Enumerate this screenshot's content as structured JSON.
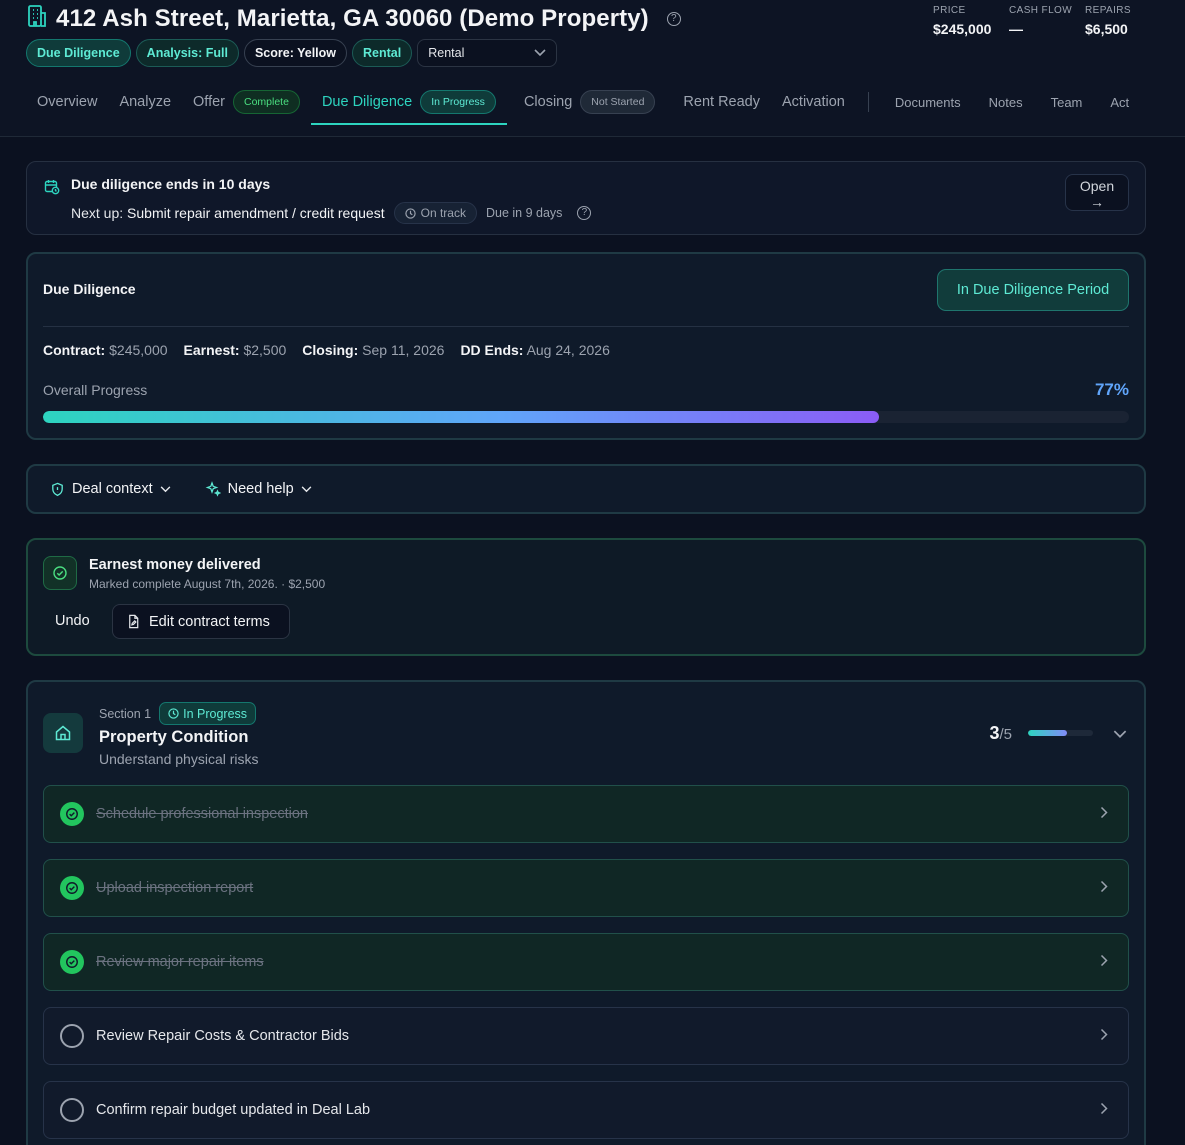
{
  "header": {
    "title": "412 Ash Street, Marietta, GA 30060 (Demo Property)",
    "pills": [
      "Due Diligence",
      "Analysis: Full",
      "Score: Yellow",
      "Rental"
    ],
    "strategy_select": "Rental",
    "stats": [
      {
        "label": "PRICE",
        "value": "$245,000"
      },
      {
        "label": "CASH FLOW",
        "value": "—"
      },
      {
        "label": "REPAIRS",
        "value": "$6,500"
      }
    ]
  },
  "tabs": [
    {
      "label": "Overview"
    },
    {
      "label": "Analyze"
    },
    {
      "label": "Offer",
      "badge": "Complete"
    },
    {
      "label": "Due Diligence",
      "badge": "In Progress",
      "active": true
    },
    {
      "label": "Closing",
      "badge": "Not Started"
    },
    {
      "label": "Rent Ready"
    },
    {
      "label": "Activation"
    }
  ],
  "secondary_tabs": [
    "Documents",
    "Notes",
    "Team",
    "Act"
  ],
  "alert": {
    "title": "Due diligence ends in 10 days",
    "next_prefix": "Next up:",
    "next_task": "Submit repair amendment / credit request",
    "status": "On track",
    "due": "Due in 9 days",
    "open_label": "Open"
  },
  "due_diligence": {
    "heading": "Due Diligence",
    "period_button": "In Due Diligence Period",
    "contract_label": "Contract:",
    "contract": "$245,000",
    "earnest_label": "Earnest:",
    "earnest": "$2,500",
    "closing_label": "Closing:",
    "closing": "Sep 11, 2026",
    "dd_ends_label": "DD Ends:",
    "dd_ends": "Aug 24, 2026",
    "progress_label": "Overall Progress",
    "progress_text": "77%",
    "progress_fraction": 0.77
  },
  "context_bar": {
    "deal_context": "Deal context",
    "need_help": "Need help"
  },
  "earnest_card": {
    "title": "Earnest money delivered",
    "subtitle": "Marked complete August 7th, 2026. · $2,500",
    "undo": "Undo",
    "edit": "Edit contract terms"
  },
  "section": {
    "label": "Section 1",
    "status": "In Progress",
    "title": "Property Condition",
    "subtitle": "Understand physical risks",
    "done": "3",
    "total": "/5",
    "progress_fraction": 0.6,
    "tasks": [
      {
        "label": "Schedule professional inspection",
        "done": true
      },
      {
        "label": "Upload inspection report",
        "done": true
      },
      {
        "label": "Review major repair items",
        "done": true
      },
      {
        "label": "Review Repair Costs & Contractor Bids",
        "done": false
      },
      {
        "label": "Confirm repair budget updated in Deal Lab",
        "done": false
      }
    ]
  },
  "colors": {
    "accent": "#2dd4bf",
    "progress_end": "#8b5cf6",
    "done_green": "#22c55e"
  }
}
